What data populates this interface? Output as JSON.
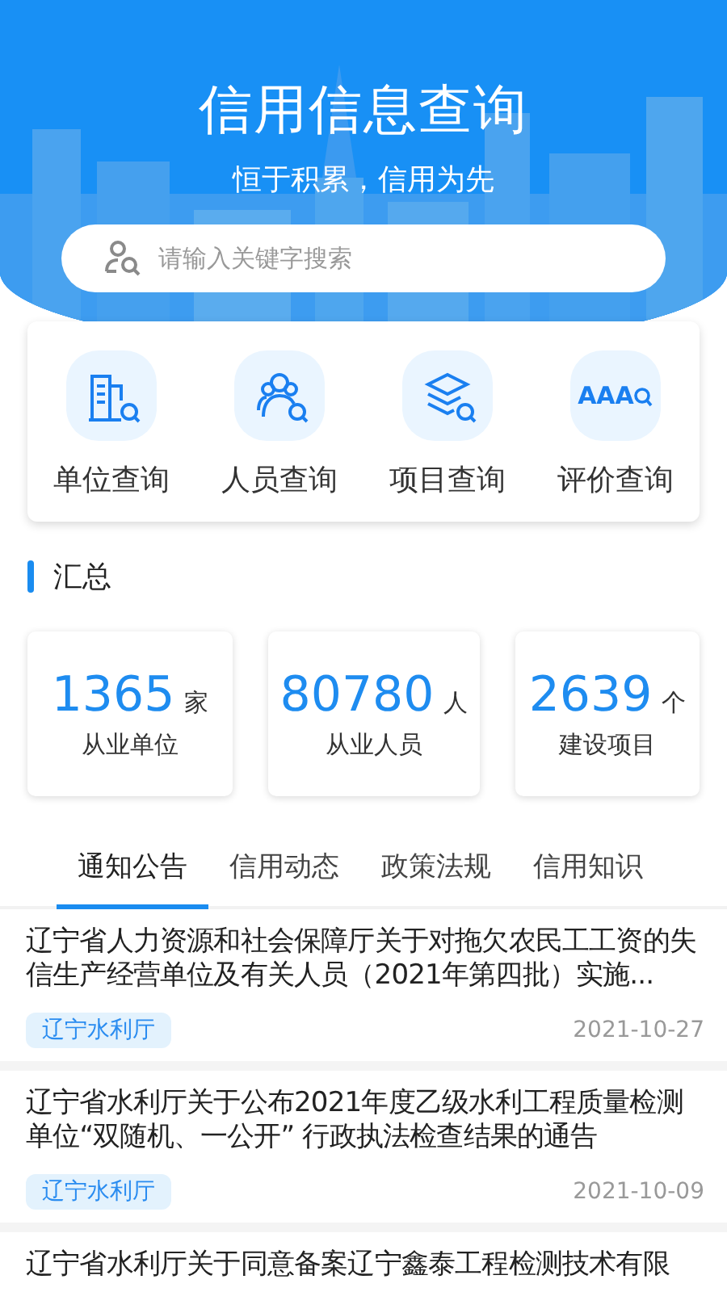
{
  "header": {
    "title": "信用信息查询",
    "slogan": "恒于积累，信用为先",
    "search": {
      "placeholder": "请输入关键字搜索"
    }
  },
  "quick_links": [
    {
      "kind": "unit",
      "label": "单位查询"
    },
    {
      "kind": "person",
      "label": "人员查询"
    },
    {
      "kind": "project",
      "label": "项目查询"
    },
    {
      "kind": "rating",
      "label": "评价查询",
      "icon_text": "AAA"
    }
  ],
  "summary": {
    "title": "汇总",
    "stats": [
      {
        "value": "1365",
        "unit": "家",
        "label": "从业单位"
      },
      {
        "value": "80780",
        "unit": "人",
        "label": "从业人员"
      },
      {
        "value": "2639",
        "unit": "个",
        "label": "建设项目"
      }
    ]
  },
  "tabs": [
    {
      "label": "通知公告",
      "selected": true
    },
    {
      "label": "信用动态",
      "selected": false
    },
    {
      "label": "政策法规",
      "selected": false
    },
    {
      "label": "信用知识",
      "selected": false
    }
  ],
  "notices": [
    {
      "title": "辽宁省人力资源和社会保障厅关于对拖欠农民工工资的失信生产经营单位及有关人员（2021年第四批）实施...",
      "tag": "辽宁水利厅",
      "date": "2021-10-27"
    },
    {
      "title": "辽宁省水利厅关于公布2021年度乙级水利工程质量检测单位“双随机、一公开” 行政执法检查结果的通告",
      "tag": "辽宁水利厅",
      "date": "2021-10-09"
    },
    {
      "title": "辽宁省水利厅关于同意备案辽宁鑫泰工程检测技术有限"
    }
  ]
}
